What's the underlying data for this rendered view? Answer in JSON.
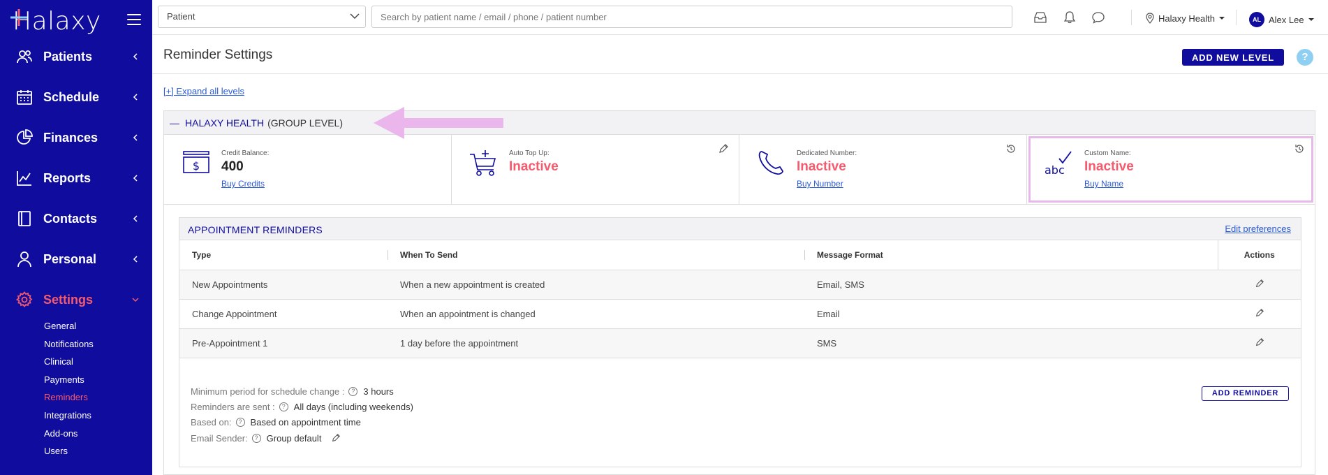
{
  "brand": {
    "name": "Halaxy",
    "accent": "#100d9e",
    "alert": "#f65a6d"
  },
  "nav": {
    "items": [
      {
        "label": "Patients",
        "icon": "patients-icon"
      },
      {
        "label": "Schedule",
        "icon": "calendar-icon"
      },
      {
        "label": "Finances",
        "icon": "pie-chart-icon"
      },
      {
        "label": "Reports",
        "icon": "line-chart-icon"
      },
      {
        "label": "Contacts",
        "icon": "address-book-icon"
      },
      {
        "label": "Personal",
        "icon": "person-icon"
      },
      {
        "label": "Settings",
        "icon": "gear-icon"
      }
    ],
    "settings_sub": [
      "General",
      "Notifications",
      "Clinical",
      "Payments",
      "Reminders",
      "Integrations",
      "Add-ons",
      "Users"
    ]
  },
  "topbar": {
    "patient_select": "Patient",
    "search_placeholder": "Search by patient name / email / phone / patient number",
    "org": "Halaxy Health",
    "user_initials": "AL",
    "user_name": "Alex Lee"
  },
  "page": {
    "title": "Reminder Settings",
    "add_level_label": "ADD NEW LEVEL",
    "help_label": "?",
    "expand_label": "[+] Expand all levels"
  },
  "level": {
    "toggle": "—",
    "name": "HALAXY HEALTH",
    "suffix": "(GROUP LEVEL)"
  },
  "cards": [
    {
      "label": "Credit Balance:",
      "value": "400",
      "link": "Buy Credits",
      "icon": "credit-balance-icon"
    },
    {
      "label": "Auto Top Up:",
      "value": "Inactive",
      "link": "",
      "icon": "cart-plus-icon"
    },
    {
      "label": "Dedicated Number:",
      "value": "Inactive",
      "link": "Buy Number",
      "icon": "phone-icon"
    },
    {
      "label": "Custom Name:",
      "value": "Inactive",
      "link": "Buy Name",
      "icon": "abc-check-icon"
    }
  ],
  "reminders": {
    "title": "APPOINTMENT REMINDERS",
    "edit_label": "Edit preferences",
    "columns": [
      "Type",
      "When To Send",
      "Message Format",
      "Actions"
    ],
    "rows": [
      {
        "type": "New Appointments",
        "when": "When a new appointment is created",
        "format": "Email, SMS"
      },
      {
        "type": "Change Appointment",
        "when": "When an appointment is changed",
        "format": "Email"
      },
      {
        "type": "Pre-Appointment 1",
        "when": "1 day before the appointment",
        "format": "SMS"
      }
    ],
    "options": [
      {
        "label": "Minimum period for schedule change :",
        "value": "3 hours"
      },
      {
        "label": "Reminders are sent :",
        "value": "All days (including weekends)"
      },
      {
        "label": "Based on:",
        "value": "Based on appointment time"
      },
      {
        "label": "Email Sender:",
        "value": "Group default"
      }
    ],
    "add_label": "ADD REMINDER"
  }
}
